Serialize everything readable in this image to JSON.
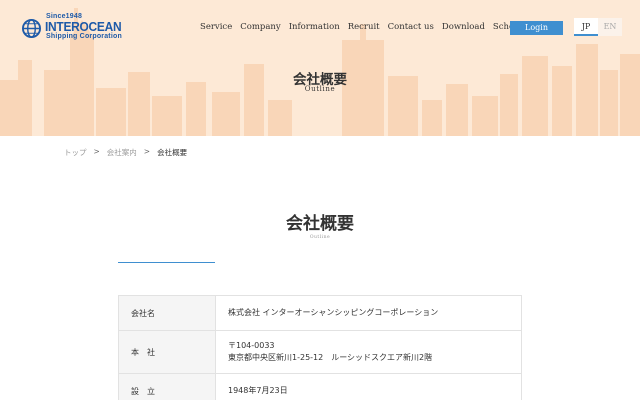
{
  "brand": {
    "since": "Since1948",
    "name": "INTEROCEAN",
    "sub": "Shipping Corporation",
    "color": "#1e5aa8"
  },
  "nav": {
    "items": [
      "Service",
      "Company",
      "Information",
      "Recruit",
      "Contact us",
      "Download",
      "Schedule"
    ],
    "login_label": "Login",
    "lang": {
      "jp": "JP",
      "en": "EN",
      "active": "JP"
    },
    "accent": "#3f8fd0"
  },
  "hero": {
    "title": "会社概要",
    "subtitle": "Outline",
    "background": "#fde9d6"
  },
  "breadcrumb": {
    "items": [
      "トップ",
      "会社案内",
      "会社概要"
    ],
    "separator": ">"
  },
  "section": {
    "title": "会社概要",
    "subtitle": "Outline"
  },
  "table": {
    "rows": [
      {
        "label": "会社名",
        "lines": [
          "株式会社 インターオーシャンシッピングコーポレーション"
        ]
      },
      {
        "label": "本　社",
        "lines": [
          "〒104-0033",
          "東京都中央区新川1-25-12　ルーシッドスクエア新川2階"
        ]
      },
      {
        "label": "設　立",
        "lines": [
          "1948年7月23日"
        ]
      }
    ]
  }
}
